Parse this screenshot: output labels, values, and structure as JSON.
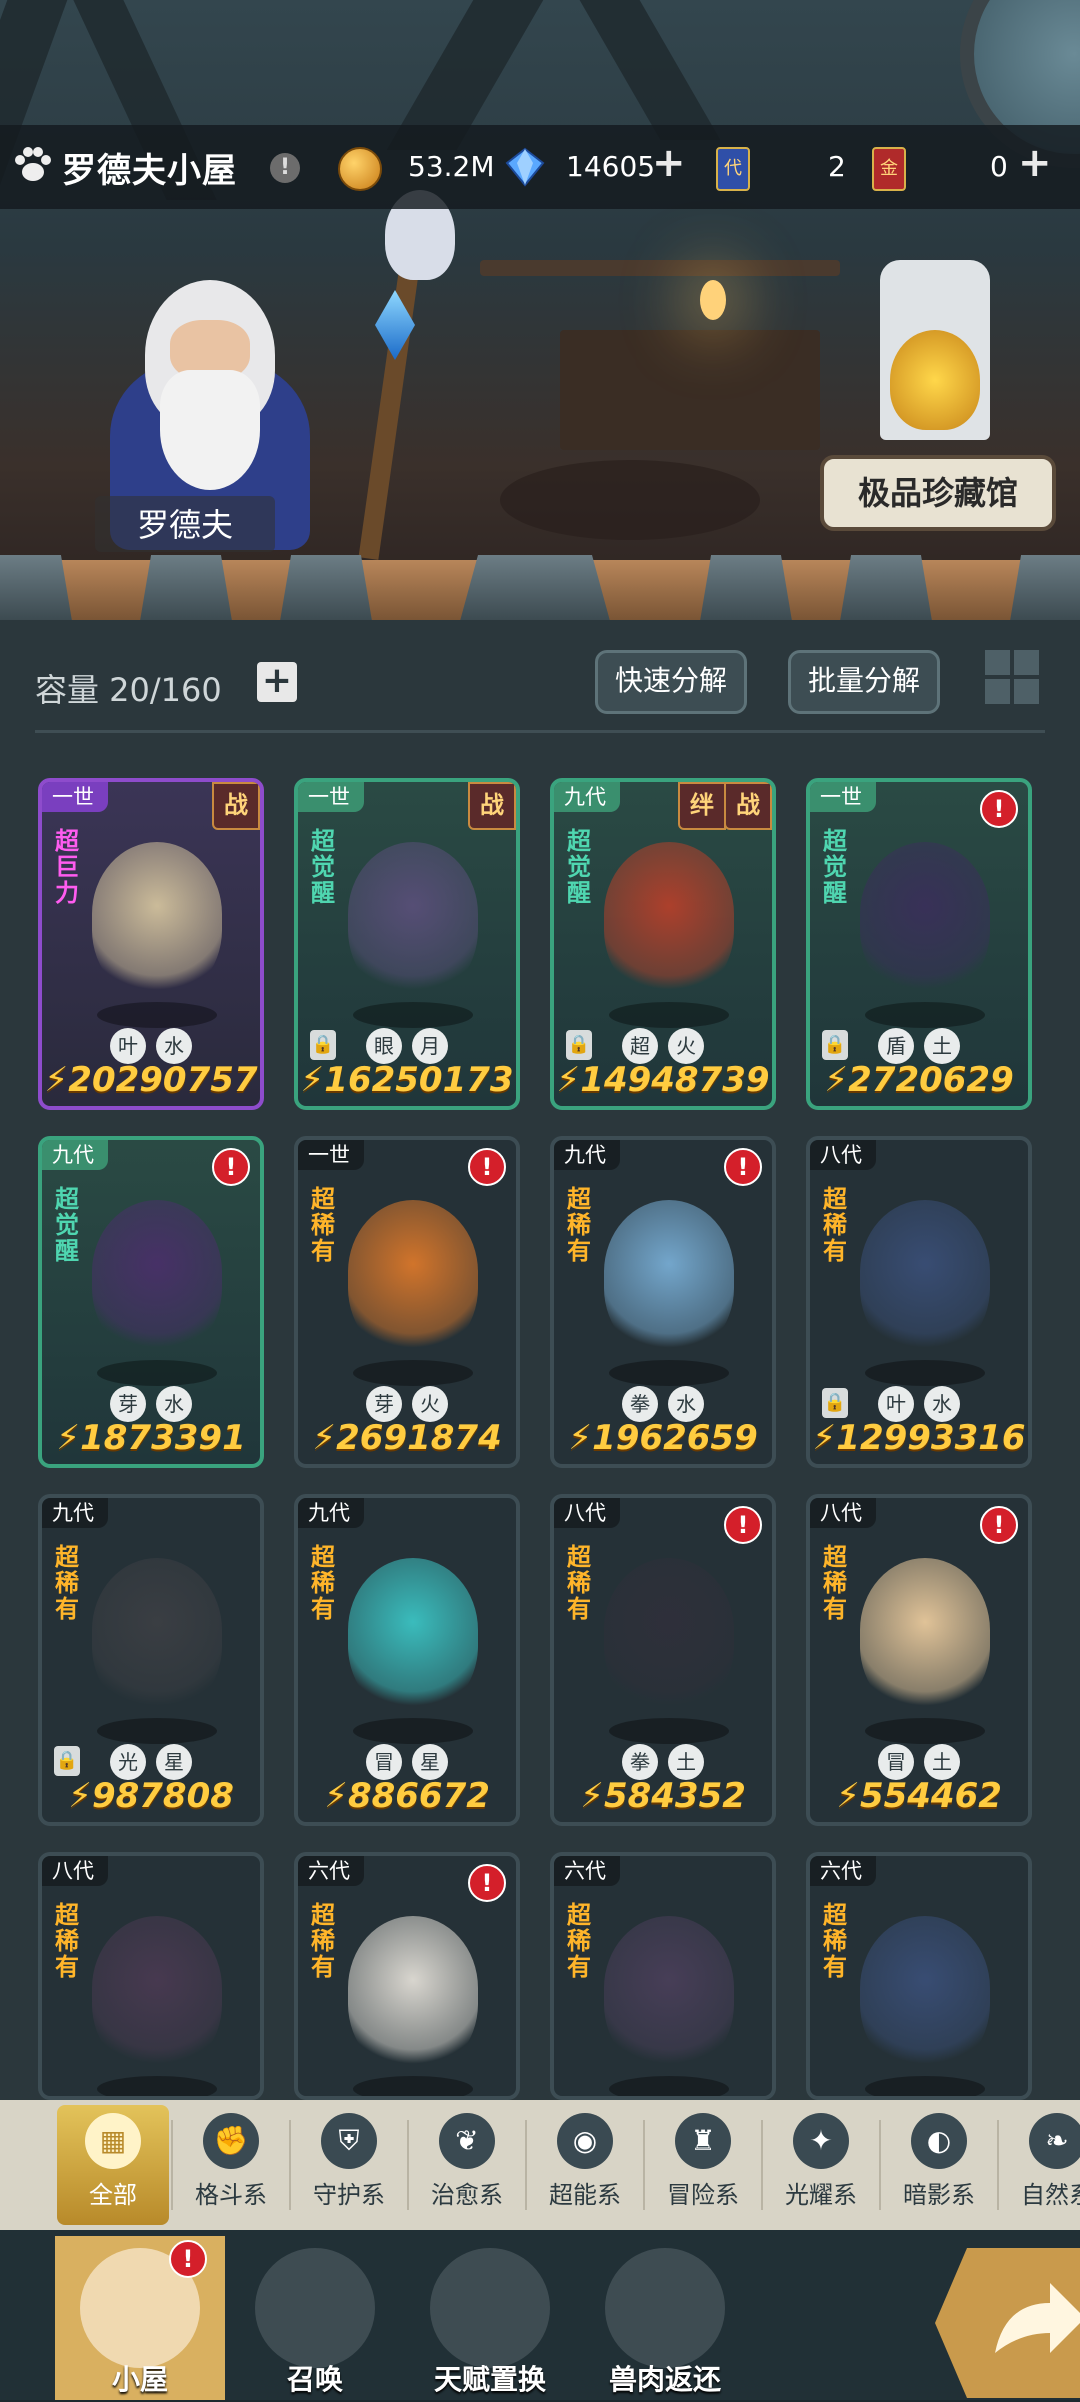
{
  "header": {
    "title": "罗德夫小屋",
    "gold": "53.2M",
    "diamonds": "14605",
    "ticket_a_count": "2",
    "ticket_b_count": "0",
    "ticket_a_mark": "代",
    "ticket_b_mark": "金"
  },
  "scene": {
    "hero_name": "罗德夫",
    "vault_label": "极品珍藏馆"
  },
  "inventory": {
    "capacity": "容量 20/160",
    "quick_decompose": "快速分解",
    "batch_decompose": "批量分解"
  },
  "pets": [
    {
      "gen": "一世",
      "rarity": "超巨力",
      "tags": [
        "战"
      ],
      "alert": false,
      "locked": false,
      "elements": [
        "叶",
        "水"
      ],
      "power": "20290757",
      "frame": "purple",
      "color": "#d8c7a0"
    },
    {
      "gen": "一世",
      "rarity": "超觉醒",
      "tags": [
        "战"
      ],
      "alert": false,
      "locked": true,
      "elements": [
        "眼",
        "月"
      ],
      "power": "16250173",
      "frame": "green",
      "color": "#5a4f7a"
    },
    {
      "gen": "九代",
      "rarity": "超觉醒",
      "tags": [
        "战",
        "绊"
      ],
      "alert": false,
      "locked": true,
      "elements": [
        "超",
        "火"
      ],
      "power": "14948739",
      "frame": "green",
      "color": "#b8402a"
    },
    {
      "gen": "一世",
      "rarity": "超觉醒",
      "tags": [],
      "alert": true,
      "locked": true,
      "elements": [
        "盾",
        "土"
      ],
      "power": "2720629",
      "frame": "green",
      "color": "#3a2f5a"
    },
    {
      "gen": "九代",
      "rarity": "超觉醒",
      "tags": [],
      "alert": true,
      "locked": false,
      "elements": [
        "芽",
        "水"
      ],
      "power": "1873391",
      "frame": "green",
      "color": "#4a2f6a"
    },
    {
      "gen": "一世",
      "rarity": "超稀有",
      "tags": [],
      "alert": true,
      "locked": false,
      "elements": [
        "芽",
        "火"
      ],
      "power": "2691874",
      "frame": "plain",
      "color": "#e07a2a"
    },
    {
      "gen": "九代",
      "rarity": "超稀有",
      "tags": [],
      "alert": true,
      "locked": false,
      "elements": [
        "拳",
        "水"
      ],
      "power": "1962659",
      "frame": "plain",
      "color": "#7ab0d8"
    },
    {
      "gen": "八代",
      "rarity": "超稀有",
      "tags": [],
      "alert": false,
      "locked": true,
      "elements": [
        "叶",
        "水"
      ],
      "power": "12993316",
      "frame": "plain",
      "color": "#3a4f78"
    },
    {
      "gen": "九代",
      "rarity": "超稀有",
      "tags": [],
      "alert": false,
      "locked": true,
      "elements": [
        "光",
        "星"
      ],
      "power": "987808",
      "frame": "plain",
      "color": "#3c3f44"
    },
    {
      "gen": "九代",
      "rarity": "超稀有",
      "tags": [],
      "alert": false,
      "locked": false,
      "elements": [
        "冒",
        "星"
      ],
      "power": "886672",
      "frame": "plain",
      "color": "#3cc8c8"
    },
    {
      "gen": "八代",
      "rarity": "超稀有",
      "tags": [],
      "alert": true,
      "locked": false,
      "elements": [
        "拳",
        "土"
      ],
      "power": "584352",
      "frame": "plain",
      "color": "#2f2f3a"
    },
    {
      "gen": "八代",
      "rarity": "超稀有",
      "tags": [],
      "alert": true,
      "locked": false,
      "elements": [
        "冒",
        "土"
      ],
      "power": "554462",
      "frame": "plain",
      "color": "#f0cfa0"
    },
    {
      "gen": "八代",
      "rarity": "超稀有",
      "tags": [],
      "alert": false,
      "locked": false,
      "elements": [],
      "power": "",
      "frame": "plain",
      "color": "#4a3a52"
    },
    {
      "gen": "六代",
      "rarity": "超稀有",
      "tags": [],
      "alert": true,
      "locked": false,
      "elements": [],
      "power": "",
      "frame": "plain",
      "color": "#e8e4dc"
    },
    {
      "gen": "六代",
      "rarity": "超稀有",
      "tags": [],
      "alert": false,
      "locked": false,
      "elements": [],
      "power": "",
      "frame": "plain",
      "color": "#4a3f5a"
    },
    {
      "gen": "六代",
      "rarity": "超稀有",
      "tags": [],
      "alert": false,
      "locked": false,
      "elements": [],
      "power": "",
      "frame": "plain",
      "color": "#3a4f78"
    }
  ],
  "categories": [
    {
      "label": "全部",
      "icon": "all-grid",
      "glyph": "▦",
      "selected": true
    },
    {
      "label": "格斗系",
      "icon": "fist",
      "glyph": "✊",
      "selected": false
    },
    {
      "label": "守护系",
      "icon": "shield",
      "glyph": "⛨",
      "selected": false
    },
    {
      "label": "治愈系",
      "icon": "sprout",
      "glyph": "❦",
      "selected": false
    },
    {
      "label": "超能系",
      "icon": "alien",
      "glyph": "◉",
      "selected": false
    },
    {
      "label": "冒险系",
      "icon": "flame-helm",
      "glyph": "♜",
      "selected": false
    },
    {
      "label": "光耀系",
      "icon": "sparkle",
      "glyph": "✦",
      "selected": false
    },
    {
      "label": "暗影系",
      "icon": "eclipse",
      "glyph": "◐",
      "selected": false
    },
    {
      "label": "自然系",
      "icon": "leaf",
      "glyph": "❧",
      "selected": false
    }
  ],
  "bottom_nav": [
    {
      "label": "小屋",
      "icon": "house",
      "selected": true,
      "alert": true
    },
    {
      "label": "召唤",
      "icon": "egg",
      "selected": false,
      "alert": false
    },
    {
      "label": "天赋置换",
      "icon": "swap-arrows",
      "selected": false,
      "alert": false
    },
    {
      "label": "兽肉返还",
      "icon": "meat",
      "selected": false,
      "alert": false
    }
  ]
}
